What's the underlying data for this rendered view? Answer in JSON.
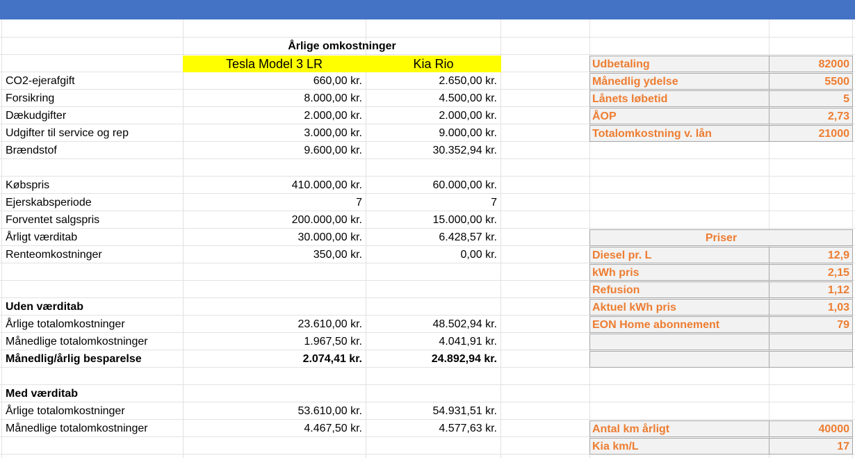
{
  "sheet": {
    "title": "Årlige omkostninger",
    "col_headers": [
      "Tesla Model 3 LR",
      "Kia Rio"
    ],
    "rows": [
      {
        "label": "CO2-ejerafgift",
        "tesla": "660,00 kr.",
        "kia": "2.650,00 kr."
      },
      {
        "label": "Forsikring",
        "tesla": "8.000,00 kr.",
        "kia": "4.500,00 kr."
      },
      {
        "label": "Dækudgifter",
        "tesla": "2.000,00 kr.",
        "kia": "2.000,00 kr."
      },
      {
        "label": "Udgifter til service og rep",
        "tesla": "3.000,00 kr.",
        "kia": "9.000,00 kr."
      },
      {
        "label": "Brændstof",
        "tesla": "9.600,00 kr.",
        "kia": "30.352,94 kr."
      },
      {
        "label": "Købspris",
        "tesla": "410.000,00 kr.",
        "kia": "60.000,00 kr."
      },
      {
        "label": "Ejerskabsperiode",
        "tesla": "7",
        "kia": "7"
      },
      {
        "label": "Forventet salgspris",
        "tesla": "200.000,00 kr.",
        "kia": "15.000,00 kr."
      },
      {
        "label": "Årligt værditab",
        "tesla": "30.000,00 kr.",
        "kia": "6.428,57 kr."
      },
      {
        "label": "Renteomkostninger",
        "tesla": "350,00 kr.",
        "kia": "0,00 kr."
      }
    ],
    "uden": {
      "heading": "Uden værditab",
      "rows": [
        {
          "label": "Årlige totalomkostninger",
          "tesla": "23.610,00 kr.",
          "kia": "48.502,94 kr."
        },
        {
          "label": "Månedlige totalomkostninger",
          "tesla": "1.967,50 kr.",
          "kia": "4.041,91 kr."
        },
        {
          "label": "Månedlig/årlig besparelse",
          "tesla": "2.074,41 kr.",
          "kia": "24.892,94 kr."
        }
      ]
    },
    "med": {
      "heading": "Med værditab",
      "rows": [
        {
          "label": "Årlige totalomkostninger",
          "tesla": "53.610,00 kr.",
          "kia": "54.931,51 kr."
        },
        {
          "label": "Månedlige totalomkostninger",
          "tesla": "4.467,50 kr.",
          "kia": "4.577,63 kr."
        }
      ]
    },
    "loan": [
      {
        "label": "Udbetaling",
        "value": "82000"
      },
      {
        "label": "Månedlig ydelse",
        "value": "5500"
      },
      {
        "label": "Lånets løbetid",
        "value": "5"
      },
      {
        "label": "ÅOP",
        "value": "2,73"
      },
      {
        "label": "Totalomkostning v. lån",
        "value": "21000"
      }
    ],
    "prices": {
      "heading": "Priser",
      "rows": [
        {
          "label": "Diesel pr. L",
          "value": "12,9"
        },
        {
          "label": "kWh pris",
          "value": "2,15"
        },
        {
          "label": "Refusion",
          "value": "1,12"
        },
        {
          "label": "Aktuel kWh pris",
          "value": "1,03"
        },
        {
          "label": "EON Home abonnement",
          "value": "79"
        },
        {
          "label": "",
          "value": ""
        },
        {
          "label": "",
          "value": ""
        }
      ]
    },
    "km": [
      {
        "label": "Antal km årligt",
        "value": "40000"
      },
      {
        "label": "Kia km/L",
        "value": "17"
      }
    ]
  },
  "colors": {
    "header_bar": "#4472c4",
    "highlight": "#ffff00",
    "accent_text": "#ed7d31",
    "panel_bg": "#f2f2f2"
  }
}
